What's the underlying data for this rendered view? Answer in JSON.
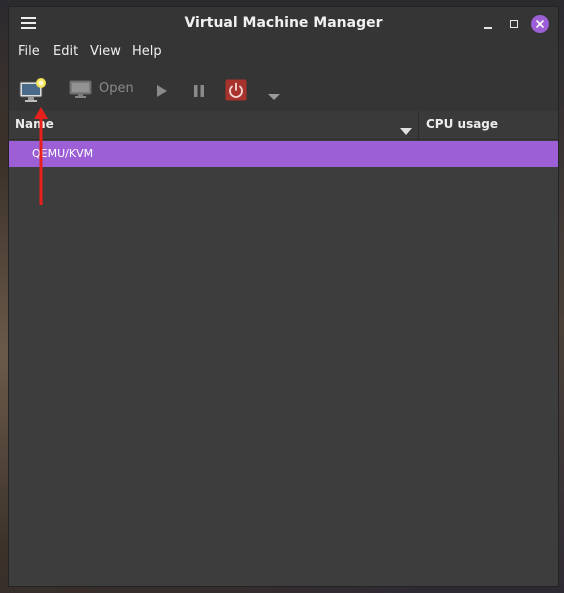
{
  "window": {
    "title": "Virtual Machine Manager"
  },
  "menu": {
    "items": [
      "File",
      "Edit",
      "View",
      "Help"
    ]
  },
  "toolbar": {
    "new_vm_icon": "new-vm-icon",
    "open_label": "Open",
    "run_icon": "play-icon",
    "pause_icon": "pause-icon",
    "shutdown_icon": "power-icon",
    "shutdown_color": "#b53a34",
    "dropdown_icon": "chevron-down-icon"
  },
  "list": {
    "columns": [
      "Name",
      "CPU usage"
    ],
    "rows": [
      {
        "name": "QEMU/KVM",
        "selected": true
      }
    ]
  },
  "colors": {
    "accent": "#9c5fd6",
    "annotation_arrow": "#e8201c"
  }
}
